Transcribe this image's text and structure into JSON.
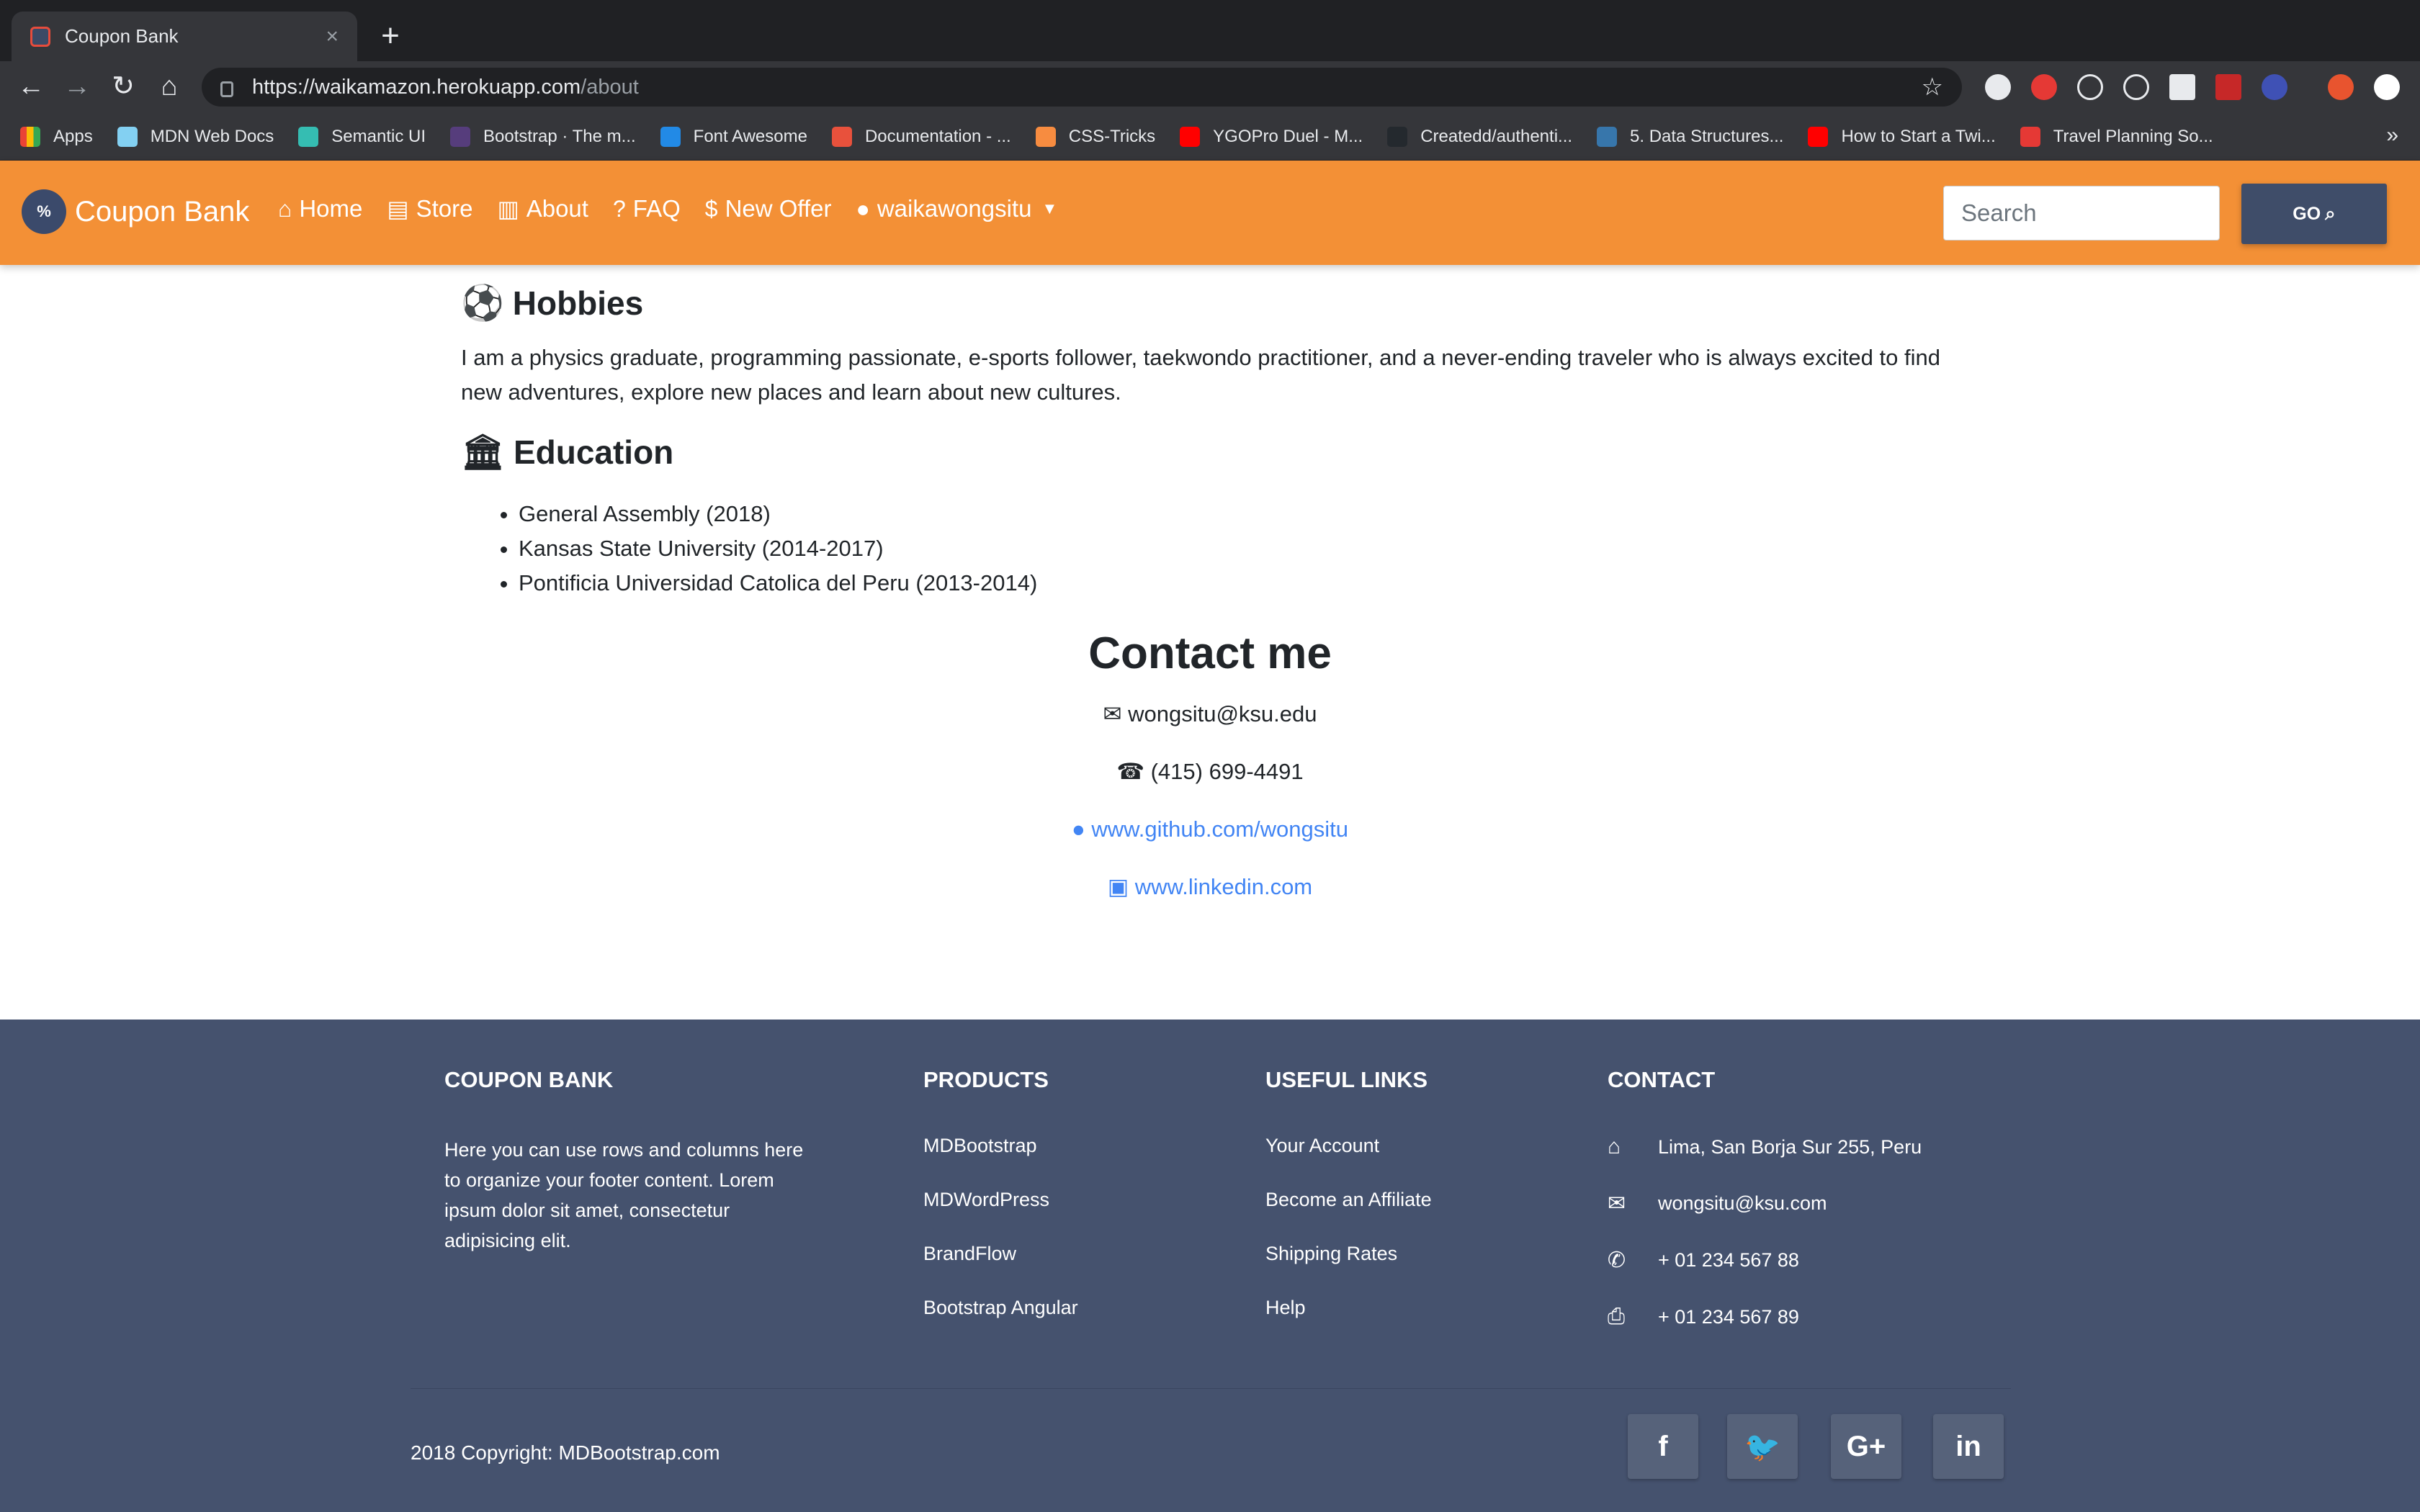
{
  "browser": {
    "tab_title": "Coupon Bank",
    "url_host": "https://waikamazon.herokuapp.com",
    "url_path": "/about",
    "bookmarks": [
      {
        "label": "Apps",
        "color": "#ea4335"
      },
      {
        "label": "MDN Web Docs",
        "color": "#83d0f2"
      },
      {
        "label": "Semantic UI",
        "color": "#35bdb2"
      },
      {
        "label": "Bootstrap · The m...",
        "color": "#563d7c"
      },
      {
        "label": "Font Awesome",
        "color": "#228ae6"
      },
      {
        "label": "Documentation - ...",
        "color": "#e8513c"
      },
      {
        "label": "CSS-Tricks",
        "color": "#f78c40"
      },
      {
        "label": "YGOPro Duel - M...",
        "color": "#ff0000"
      },
      {
        "label": "Createdd/authenti...",
        "color": "#24292e"
      },
      {
        "label": "5. Data Structures...",
        "color": "#3776ab"
      },
      {
        "label": "How to Start a Twi...",
        "color": "#ff0000"
      },
      {
        "label": "Travel Planning So...",
        "color": "#e53935"
      }
    ]
  },
  "navbar": {
    "brand": "Coupon Bank",
    "links": [
      {
        "icon": "home-icon",
        "glyph": "⌂",
        "label": "Home"
      },
      {
        "icon": "store-icon",
        "glyph": "▤",
        "label": "Store"
      },
      {
        "icon": "building-icon",
        "glyph": "▥",
        "label": "About"
      },
      {
        "icon": "question-icon",
        "glyph": "?",
        "label": "FAQ"
      },
      {
        "icon": "hand-dollar-icon",
        "glyph": "$",
        "label": "New Offer"
      },
      {
        "icon": "user-icon",
        "glyph": "●",
        "label": "waikawongsitu"
      }
    ],
    "search_placeholder": "Search",
    "go_label": "GO"
  },
  "about": {
    "hobbies_title": "Hobbies",
    "hobbies_text": "I am a physics graduate, programming passionate, e-sports follower, taekwondo practitioner, and a never-ending traveler who is always excited to find new adventures, explore new places and learn about new cultures.",
    "education_title": "Education",
    "education": [
      "General Assembly (2018)",
      "Kansas State University (2014-2017)",
      "Pontificia Universidad Catolica del Peru (2013-2014)"
    ],
    "contact_title": "Contact me",
    "email": "wongsitu@ksu.edu",
    "phone": "(415) 699-4491",
    "github": "www.github.com/wongsitu",
    "linkedin": "www.linkedin.com"
  },
  "footer": {
    "col1_title": "COUPON BANK",
    "col1_text": "Here you can use rows and columns here to organize your footer content. Lorem ipsum dolor sit amet, consectetur adipisicing elit.",
    "products_title": "PRODUCTS",
    "products": [
      "MDBootstrap",
      "MDWordPress",
      "BrandFlow",
      "Bootstrap Angular"
    ],
    "links_title": "USEFUL LINKS",
    "links": [
      "Your Account",
      "Become an Affiliate",
      "Shipping Rates",
      "Help"
    ],
    "contact_title": "CONTACT",
    "contact": [
      {
        "icon": "home-icon",
        "glyph": "⌂",
        "text": "Lima, San Borja Sur 255, Peru"
      },
      {
        "icon": "envelope-icon",
        "glyph": "✉",
        "text": "wongsitu@ksu.com"
      },
      {
        "icon": "phone-icon",
        "glyph": "✆",
        "text": "+ 01 234 567 88"
      },
      {
        "icon": "print-icon",
        "glyph": "⎙",
        "text": "+ 01 234 567 89"
      }
    ],
    "copyright_prefix": "2018 Copyright:",
    "copyright_link": "MDBootstrap.com"
  }
}
